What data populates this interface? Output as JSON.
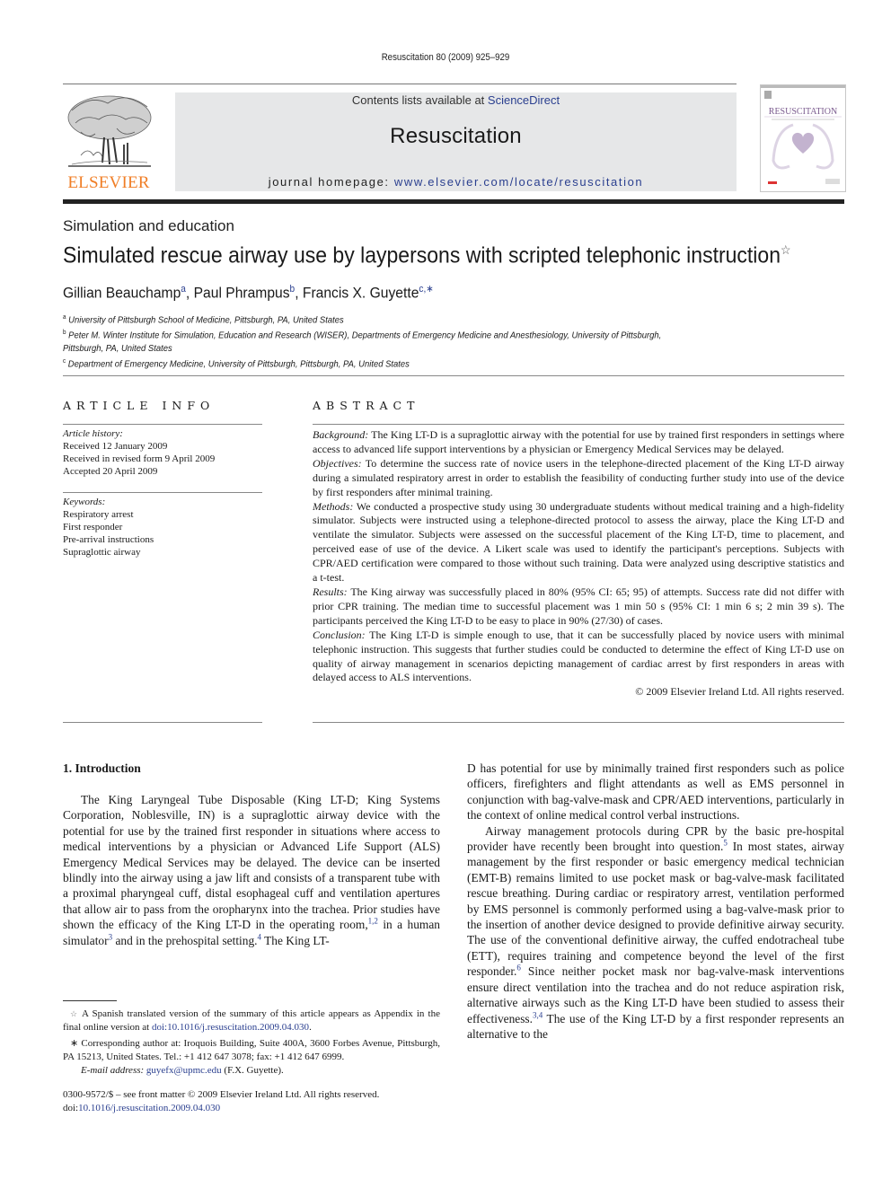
{
  "running_head": "Resuscitation 80 (2009) 925–929",
  "banner": {
    "contents_prefix": "Contents lists available at ",
    "contents_link": "ScienceDirect",
    "journal_title": "Resuscitation",
    "homepage_prefix": "journal homepage: ",
    "homepage_link": "www.elsevier.com/locate/resuscitation"
  },
  "publisher_logo": {
    "wordmark": "ELSEVIER",
    "icon": "elsevier-tree-icon",
    "color": "#f07e26"
  },
  "cover": {
    "title": "RESUSCITATION",
    "icon": "lungs-heart-icon",
    "accent": "#8a6f9e"
  },
  "section_label": "Simulation and education",
  "article": {
    "title": "Simulated rescue airway use by laypersons with scripted telephonic instruction",
    "title_note_marker": "☆",
    "authors": [
      {
        "name": "Gillian Beauchamp",
        "sup": "a"
      },
      {
        "name": "Paul Phrampus",
        "sup": "b"
      },
      {
        "name": "Francis X. Guyette",
        "sup": "c,∗"
      }
    ],
    "affiliations": [
      {
        "key": "a",
        "text": "University of Pittsburgh School of Medicine, Pittsburgh, PA, United States"
      },
      {
        "key": "b",
        "text": "Peter M. Winter Institute for Simulation, Education and Research (WISER), Departments of Emergency Medicine and Anesthesiology, University of Pittsburgh,",
        "text2": "Pittsburgh, PA, United States"
      },
      {
        "key": "c",
        "text": "Department of Emergency Medicine, University of Pittsburgh, Pittsburgh, PA, United States"
      }
    ]
  },
  "article_info": {
    "heading": "ARTICLE INFO",
    "history_label": "Article history:",
    "history": [
      "Received 12 January 2009",
      "Received in revised form 9 April 2009",
      "Accepted 20 April 2009"
    ],
    "keywords_label": "Keywords:",
    "keywords": [
      "Respiratory arrest",
      "First responder",
      "Pre-arrival instructions",
      "Supraglottic airway"
    ]
  },
  "abstract": {
    "heading": "ABSTRACT",
    "sections": [
      {
        "label": "Background:",
        "text": " The King LT-D is a supraglottic airway with the potential for use by trained first responders in settings where access to advanced life support interventions by a physician or Emergency Medical Services may be delayed."
      },
      {
        "label": "Objectives:",
        "text": " To determine the success rate of novice users in the telephone-directed placement of the King LT-D airway during a simulated respiratory arrest in order to establish the feasibility of conducting further study into use of the device by first responders after minimal training."
      },
      {
        "label": "Methods:",
        "text": " We conducted a prospective study using 30 undergraduate students without medical training and a high-fidelity simulator. Subjects were instructed using a telephone-directed protocol to assess the airway, place the King LT-D and ventilate the simulator. Subjects were assessed on the successful placement of the King LT-D, time to placement, and perceived ease of use of the device. A Likert scale was used to identify the participant's perceptions. Subjects with CPR/AED certification were compared to those without such training. Data were analyzed using descriptive statistics and a t-test."
      },
      {
        "label": "Results:",
        "text": " The King airway was successfully placed in 80% (95% CI: 65; 95) of attempts. Success rate did not differ with prior CPR training. The median time to successful placement was 1 min 50 s (95% CI: 1 min 6 s; 2 min 39 s). The participants perceived the King LT-D to be easy to place in 90% (27/30) of cases."
      },
      {
        "label": "Conclusion:",
        "text": " The King LT-D is simple enough to use, that it can be successfully placed by novice users with minimal telephonic instruction. This suggests that further studies could be conducted to determine the effect of King LT-D use on quality of airway management in scenarios depicting management of cardiac arrest by first responders in areas with delayed access to ALS interventions."
      }
    ],
    "copyright": "© 2009 Elsevier Ireland Ltd. All rights reserved."
  },
  "introduction": {
    "heading": "1.  Introduction",
    "left_p1_a": "The King Laryngeal Tube Disposable (King LT-D; King Systems Corporation, Noblesville, IN) is a supraglottic airway device with the potential for use by the trained first responder in situations where access to medical interventions by a physician or Advanced Life Support (ALS) Emergency Medical Services may be delayed. The device can be inserted blindly into the airway using a jaw lift and consists of a transparent tube with a proximal pharyngeal cuff, distal esophageal cuff and ventilation apertures that allow air to pass from the oropharynx into the trachea. Prior studies have shown the efficacy of the King LT-D in the operating room,",
    "ref_a": "1,2",
    "left_p1_b": " in a human simulator",
    "ref_b": "3",
    "left_p1_c": " and in the prehospital setting.",
    "ref_c": "4",
    "left_p1_d": " The King LT-",
    "right_p1": "D has potential for use by minimally trained first responders such as police officers, firefighters and flight attendants as well as EMS personnel in conjunction with bag-valve-mask and CPR/AED interventions, particularly in the context of online medical control verbal instructions.",
    "right_p2_a": "Airway management protocols during CPR by the basic pre-hospital provider have recently been brought into question.",
    "ref_d": "5",
    "right_p2_b": " In most states, airway management by the first responder or basic emergency medical technician (EMT-B) remains limited to use pocket mask or bag-valve-mask facilitated rescue breathing. During cardiac or respiratory arrest, ventilation performed by EMS personnel is commonly performed using a bag-valve-mask prior to the insertion of another device designed to provide definitive airway security. The use of the conventional definitive airway, the cuffed endotracheal tube (ETT), requires training and competence beyond the level of the first responder.",
    "ref_e": "6",
    "right_p2_c": " Since neither pocket mask nor bag-valve-mask interventions ensure direct ventilation into the trachea and do not reduce aspiration risk, alternative airways such as the King LT-D have been studied to assess their effectiveness.",
    "ref_f": "3,4",
    "right_p2_d": " The use of the King LT-D by a first responder represents an alternative to the"
  },
  "footnotes": {
    "star_marker": "☆",
    "star_text": " A Spanish translated version of the summary of this article appears as Appendix in the final online version at ",
    "star_link": "doi:10.1016/j.resuscitation.2009.04.030",
    "corr_marker": "∗",
    "corr_text": " Corresponding author at: Iroquois Building, Suite 400A, 3600 Forbes Avenue, Pittsburgh, PA 15213, United States. Tel.: +1 412 647 3078; fax: +1 412 647 6999.",
    "email_label": "E-mail address:",
    "email": "guyefx@upmc.edu",
    "email_suffix": " (F.X. Guyette)."
  },
  "front_matter": {
    "issn_line": "0300-9572/$ – see front matter © 2009 Elsevier Ireland Ltd. All rights reserved.",
    "doi_prefix": "doi:",
    "doi": "10.1016/j.resuscitation.2009.04.030"
  }
}
